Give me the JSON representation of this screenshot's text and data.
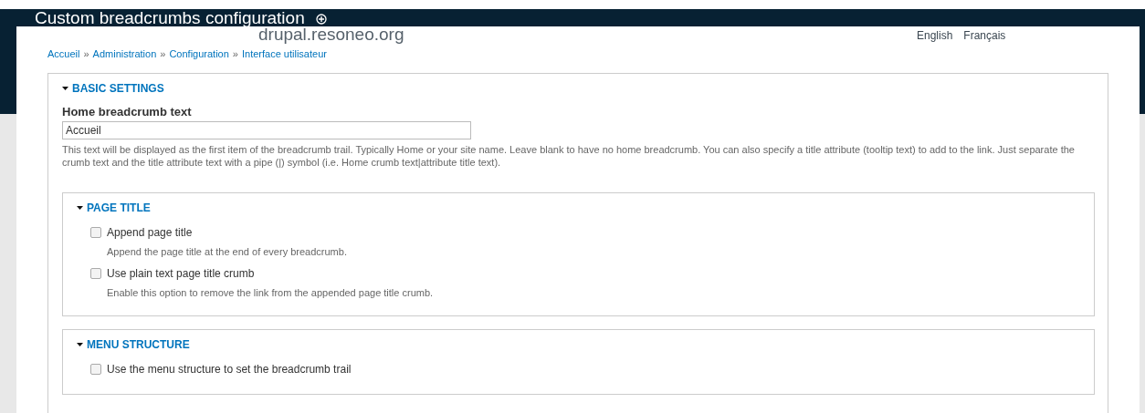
{
  "window": {
    "title": "Custom breadcrumbs configuration"
  },
  "background": {
    "site_name": "drupal.resoneo.org",
    "languages": [
      "English",
      "Français"
    ]
  },
  "breadcrumb": [
    {
      "label": "Accueil",
      "separator": "»"
    },
    {
      "label": "Administration",
      "separator": "»"
    },
    {
      "label": "Configuration",
      "separator": "»"
    },
    {
      "label": "Interface utilisateur"
    }
  ],
  "sections": [
    {
      "title": "BASIC SETTINGS",
      "expanded": true,
      "fields": [
        {
          "kind": "text",
          "label": "Home breadcrumb text",
          "value": "Accueil",
          "description": "This text will be displayed as the first item of the breadcrumb trail. Typically Home or your site name. Leave blank to have no home breadcrumb. You can also specify a title attribute (tooltip text) to add to the link. Just separate the crumb text and the title attribute text with a pipe (|) symbol (i.e. Home crumb text|attribute title text)."
        }
      ],
      "children": [
        {
          "title": "PAGE TITLE",
          "expanded": true,
          "fields": [
            {
              "kind": "checkbox",
              "label": "Append page title",
              "checked": false,
              "description": "Append the page title at the end of every breadcrumb."
            },
            {
              "kind": "checkbox",
              "label": "Use plain text page title crumb",
              "checked": false,
              "description": "Enable this option to remove the link from the appended page title crumb."
            }
          ]
        },
        {
          "title": "MENU STRUCTURE",
          "expanded": true,
          "fields": [
            {
              "kind": "checkbox",
              "label": "Use the menu structure to set the breadcrumb trail",
              "checked": false
            }
          ]
        }
      ]
    }
  ]
}
